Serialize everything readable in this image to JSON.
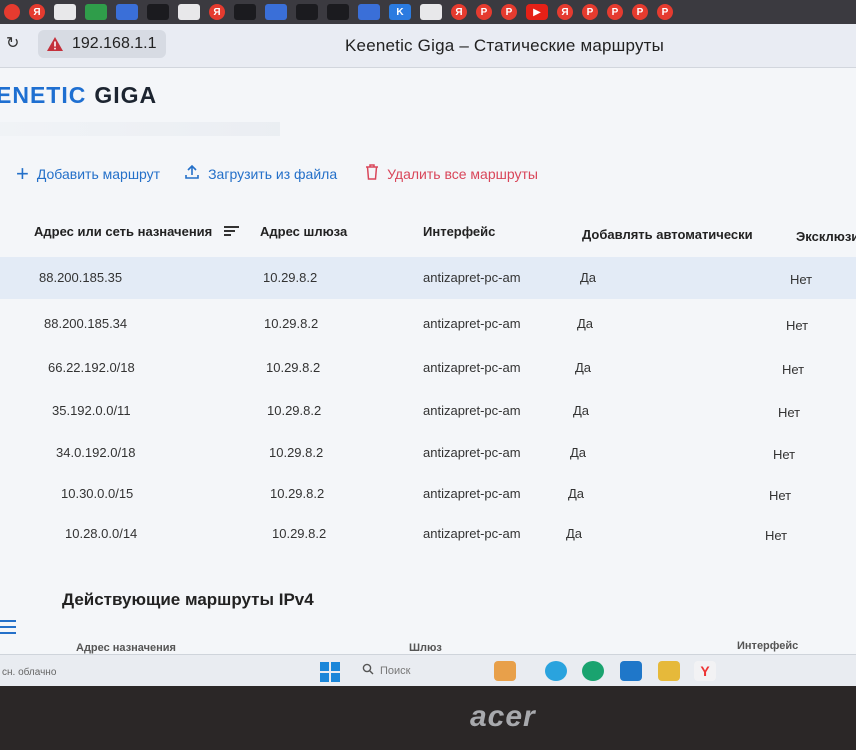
{
  "browser": {
    "address": "192.168.1.1",
    "title": "Keenetic Giga – Статические маршруты"
  },
  "logo": {
    "part1": "ENETIC",
    "part2": "GIGA"
  },
  "actions": {
    "add": "Добавить маршрут",
    "upload": "Загрузить из файла",
    "delete": "Удалить все маршруты"
  },
  "table": {
    "headers": {
      "destination": "Адрес или сеть назначения",
      "gateway": "Адрес шлюза",
      "interface": "Интерфейс",
      "auto": "Добавлять автоматически",
      "exclusive": "Эксклюзи"
    },
    "rows": [
      {
        "destination": "88.200.185.35",
        "gateway": "10.29.8.2",
        "interface": "antizapret-pc-am",
        "auto": "Да",
        "exclusive": "Нет"
      },
      {
        "destination": "88.200.185.34",
        "gateway": "10.29.8.2",
        "interface": "antizapret-pc-am",
        "auto": "Да",
        "exclusive": "Нет"
      },
      {
        "destination": "66.22.192.0/18",
        "gateway": "10.29.8.2",
        "interface": "antizapret-pc-am",
        "auto": "Да",
        "exclusive": "Нет"
      },
      {
        "destination": "35.192.0.0/11",
        "gateway": "10.29.8.2",
        "interface": "antizapret-pc-am",
        "auto": "Да",
        "exclusive": "Нет"
      },
      {
        "destination": "34.0.192.0/18",
        "gateway": "10.29.8.2",
        "interface": "antizapret-pc-am",
        "auto": "Да",
        "exclusive": "Нет"
      },
      {
        "destination": "10.30.0.0/15",
        "gateway": "10.29.8.2",
        "interface": "antizapret-pc-am",
        "auto": "Да",
        "exclusive": "Нет"
      },
      {
        "destination": "10.28.0.0/14",
        "gateway": "10.29.8.2",
        "interface": "antizapret-pc-am",
        "auto": "Да",
        "exclusive": "Нет"
      }
    ]
  },
  "active_routes": {
    "title": "Действующие маршруты IPv4",
    "headers": {
      "destination": "Адрес назначения",
      "gateway": "Шлюз",
      "interface": "Интерфейс"
    }
  },
  "taskbar": {
    "weather": "сн. облачно",
    "search": "Поиск"
  },
  "laptop": {
    "brand": "acer"
  },
  "colors": {
    "accent": "#2470c9",
    "danger": "#d9465a",
    "row_highlight": "#e3ebf6"
  }
}
